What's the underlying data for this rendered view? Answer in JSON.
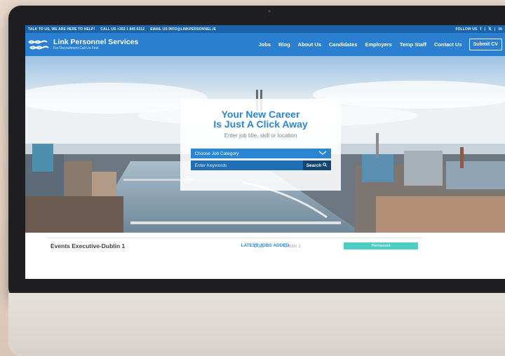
{
  "topbar": {
    "talk": "TALK TO US, WE ARE HERE TO HELP!",
    "call": "CALL US +353 1 845 6312",
    "email": "EMAIL US INFO@LINKPERSONNEL.IE",
    "follow": "FOLLOW US",
    "social_facebook": "f",
    "social_twitter": "𝕏",
    "social_linkedin": "in"
  },
  "brand": {
    "name": "Link Personnel Services",
    "tagline": "For Recruitment Call Us First"
  },
  "nav": {
    "items": [
      "Jobs",
      "Blog",
      "About Us",
      "Candidates",
      "Employers",
      "Temp Staff",
      "Contact Us"
    ],
    "submit_cv": "Submit CV"
  },
  "hero": {
    "title_line1": "Your New Career",
    "title_line2": "Is Just A Click Away",
    "subtitle": "Enter job title, skill or location",
    "category_label": "Choose Job Category",
    "keywords_placeholder": "Enter Keywords",
    "search_label": "Search"
  },
  "latest": {
    "heading": "LATEST JOBS ADDED",
    "jobs": [
      {
        "title": "Events Executive-Dublin 1",
        "salary": "DOE",
        "location": "Dublin 1",
        "type": "Permanent"
      }
    ]
  },
  "colors": {
    "topbar": "#1a63a8",
    "navbar": "#2a7fd0",
    "accent": "#2b86d6",
    "search_button": "#12456f",
    "badge": "#4ecdc4"
  }
}
